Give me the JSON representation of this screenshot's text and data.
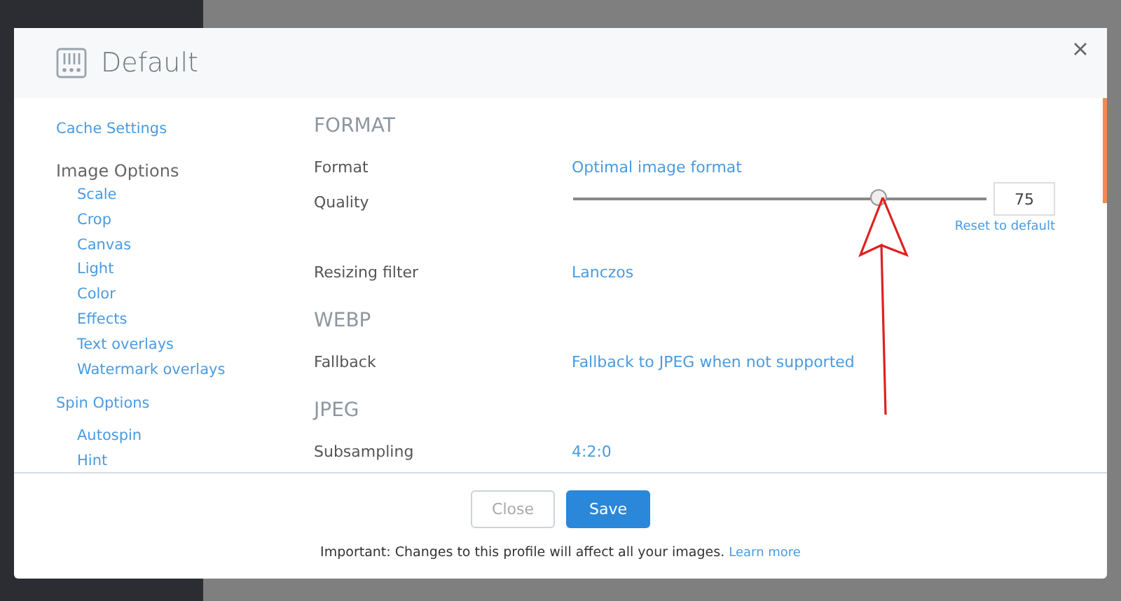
{
  "dialog": {
    "title": "Default"
  },
  "sidebar": {
    "items": [
      {
        "label": "Cache Settings",
        "kind": "link"
      },
      {
        "label": "Image Options",
        "kind": "heading",
        "children": [
          {
            "label": "Scale"
          },
          {
            "label": "Crop"
          },
          {
            "label": "Canvas"
          },
          {
            "label": "Light"
          },
          {
            "label": "Color"
          },
          {
            "label": "Effects"
          },
          {
            "label": "Text overlays"
          },
          {
            "label": "Watermark overlays"
          }
        ]
      },
      {
        "label": "Spin Options",
        "kind": "link",
        "children": [
          {
            "label": "Autospin"
          },
          {
            "label": "Hint"
          }
        ]
      }
    ]
  },
  "sections": [
    {
      "title": "FORMAT",
      "rows": [
        {
          "kind": "link",
          "label": "Format",
          "value": "Optimal image format"
        },
        {
          "kind": "slider",
          "label": "Quality",
          "level": 0.74,
          "value": "75",
          "reset": "Reset to default"
        },
        {
          "kind": "link",
          "label": "Resizing filter",
          "value": "Lanczos"
        }
      ]
    },
    {
      "title": "WEBP",
      "rows": [
        {
          "kind": "link",
          "label": "Fallback",
          "value": "Fallback to JPEG when not supported"
        }
      ]
    },
    {
      "title": "JPEG",
      "rows": [
        {
          "kind": "link",
          "label": "Subsampling",
          "value": "4:2:0"
        }
      ]
    }
  ],
  "buttons": [
    {
      "label": "Close",
      "kind": "secondary"
    },
    {
      "label": "Save",
      "kind": "primary"
    }
  ],
  "notice": {
    "text": "Important: Changes to this profile will affect all your images.",
    "link": "Learn more"
  }
}
